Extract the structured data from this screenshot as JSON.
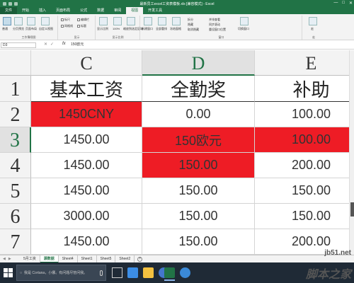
{
  "window": {
    "title": "最新员工excel工资表模板.xls [兼容模式] - Excel",
    "min_glyph": "—",
    "max_glyph": "□",
    "close_glyph": "✕"
  },
  "ribbon_tabs": [
    "文件",
    "开始",
    "插入",
    "页面布局",
    "公式",
    "数据",
    "审阅",
    "视图",
    "开发工具"
  ],
  "ribbon": {
    "view_normal": "普通",
    "view_page_break": "分页预览",
    "view_page_layout": "页面布局",
    "view_custom": "自定义视图",
    "group_workbook_views": "工作簿视图",
    "show_ruler": "标尺",
    "show_formula_bar": "编辑栏",
    "show_gridlines": "网格线",
    "show_headings": "标题",
    "group_show": "显示",
    "zoom": "显示比例",
    "zoom_100": "100%",
    "zoom_selection": "缩放到选定区域",
    "group_zoom": "显示比例",
    "new_window": "新建窗口",
    "arrange_all": "全部重排",
    "freeze_panes": "冻结窗格",
    "split": "拆分",
    "hide": "隐藏",
    "unhide": "取消隐藏",
    "view_side_by_side": "并排查看",
    "sync_scroll": "同步滚动",
    "reset_position": "重设窗口位置",
    "switch_windows": "切换窗口",
    "group_window": "窗口",
    "macros": "宏",
    "group_macros": "宏"
  },
  "formula_bar": {
    "name_box": "D3",
    "fx": "fx",
    "formula": "150欧元"
  },
  "columns": [
    "C",
    "D",
    "E"
  ],
  "rows": [
    "1",
    "2",
    "3",
    "4",
    "5",
    "6",
    "7"
  ],
  "cells": [
    [
      "基本工资",
      "全勤奖",
      "补助"
    ],
    [
      "1450CNY",
      "0.00",
      "100.00"
    ],
    [
      "1450.00",
      "150欧元",
      "100.00"
    ],
    [
      "1450.00",
      "150.00",
      "200.00"
    ],
    [
      "1450.00",
      "150.00",
      "150.00"
    ],
    [
      "3000.00",
      "150.00",
      "150.00"
    ],
    [
      "1450.00",
      "150.00",
      "200.00"
    ]
  ],
  "colors": {
    "excel_green": "#217346",
    "highlight_red": "#ee1c25"
  },
  "sheet_tabs": [
    "5月工资",
    "源数据",
    "Sheet4",
    "Sheet1",
    "Sheet5",
    "Sheet2"
  ],
  "active_sheet": "源数据",
  "add_sheet": "+",
  "taskbar": {
    "search_placeholder": "我是 Cortana，小娜。有问题尽管问我。"
  },
  "watermark": {
    "line1": "jb51.net",
    "line2": "脚本之家"
  }
}
